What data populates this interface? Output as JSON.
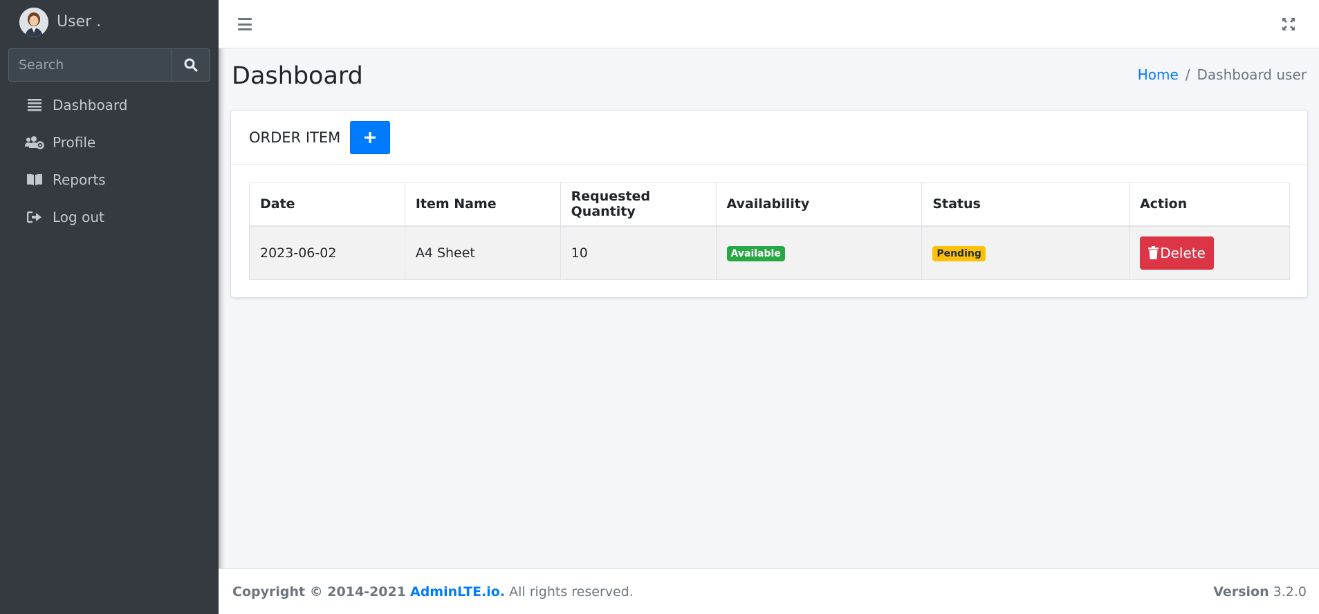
{
  "sidebar": {
    "user_name": "User .",
    "search": {
      "placeholder": "Search",
      "value": ""
    },
    "items": [
      {
        "label": "Dashboard",
        "icon": "list-icon"
      },
      {
        "label": "Profile",
        "icon": "users-cog-icon"
      },
      {
        "label": "Reports",
        "icon": "book-open-icon"
      },
      {
        "label": "Log out",
        "icon": "sign-out-icon"
      }
    ]
  },
  "header": {
    "title": "Dashboard",
    "breadcrumb": {
      "home": "Home",
      "separator": "/",
      "current": "Dashboard user"
    }
  },
  "card": {
    "title": "ORDER ITEM",
    "add_button": "+",
    "table": {
      "columns": [
        "Date",
        "Item Name",
        "Requested Quantity",
        "Availability",
        "Status",
        "Action"
      ],
      "rows": [
        {
          "date": "2023-06-02",
          "item_name": "A4 Sheet",
          "quantity": "10",
          "availability": "Available",
          "status": "Pending",
          "action": "Delete"
        }
      ]
    }
  },
  "footer": {
    "copyright": "Copyright © 2014-2021",
    "brand": "AdminLTE.io.",
    "rights": "All rights reserved.",
    "version_label": "Version",
    "version": "3.2.0"
  },
  "colors": {
    "sidebar_bg": "#343a40",
    "primary": "#007bff",
    "success": "#28a745",
    "warning": "#ffc107",
    "danger": "#dc3545"
  }
}
